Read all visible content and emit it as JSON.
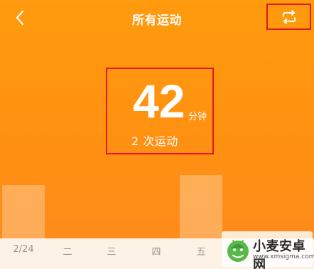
{
  "header": {
    "title": "所有运动",
    "back_icon": "chevron-left-icon",
    "switch_icon": "repeat-switch-icon"
  },
  "summary": {
    "minutes": "42",
    "minutes_unit": "分钟",
    "count_text": "2 次运动"
  },
  "chart_data": {
    "type": "bar",
    "categories": [
      "2/24",
      "二",
      "三",
      "四",
      "五"
    ],
    "values": [
      39,
      null,
      null,
      null,
      46
    ],
    "value_unit": "分钟",
    "ylim": [
      0,
      60
    ],
    "grid": false
  },
  "watermark": {
    "name": "小麦安卓网",
    "url": "www.xmsigma.com"
  },
  "colors": {
    "background_top": "#ff9b0e",
    "background_bottom": "#ff8a1e",
    "highlight_border": "#e3161b",
    "axis_background": "#fdf2e6",
    "axis_text": "#9e9385"
  }
}
